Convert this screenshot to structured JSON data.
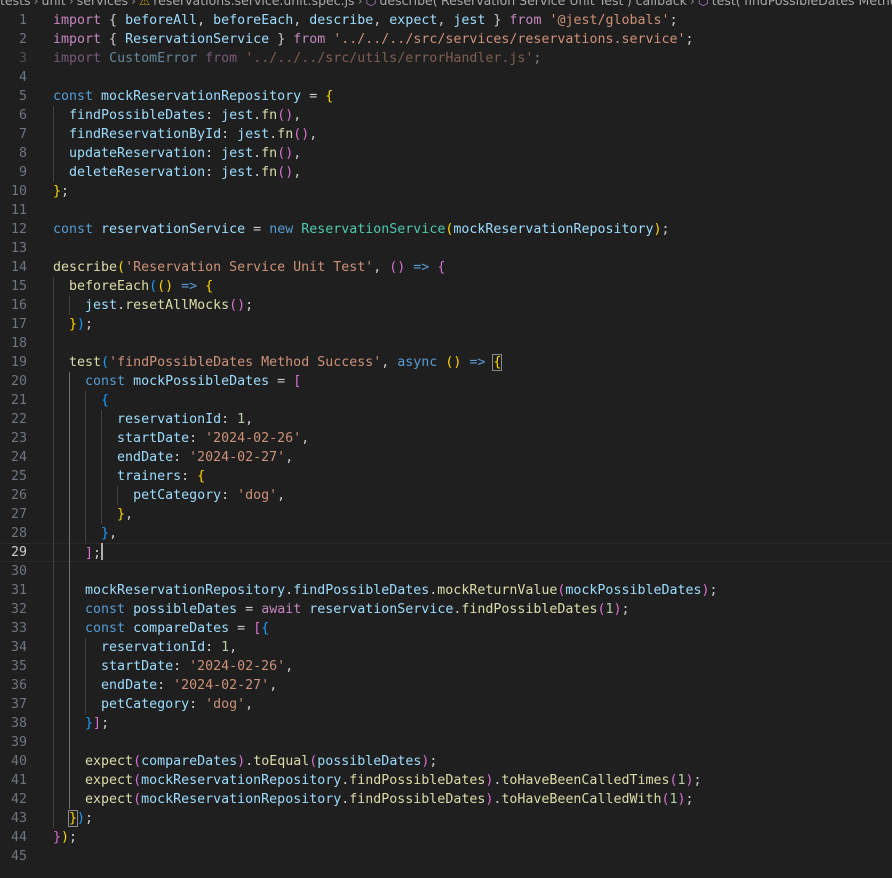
{
  "breadcrumb": {
    "parts": [
      "tests",
      "unit",
      "services",
      "reservations.service.unit.spec.js",
      "describe('Reservation Service Unit Test') callback",
      "test('findPossibleDates Method Success"
    ]
  },
  "editor": {
    "current_line": 29,
    "lines": [
      {
        "n": "1"
      },
      {
        "n": "2"
      },
      {
        "n": "3"
      },
      {
        "n": "4"
      },
      {
        "n": "5"
      },
      {
        "n": "6"
      },
      {
        "n": "7"
      },
      {
        "n": "8"
      },
      {
        "n": "9"
      },
      {
        "n": "10"
      },
      {
        "n": "11"
      },
      {
        "n": "12"
      },
      {
        "n": "13"
      },
      {
        "n": "14"
      },
      {
        "n": "15"
      },
      {
        "n": "16"
      },
      {
        "n": "17"
      },
      {
        "n": "18"
      },
      {
        "n": "19"
      },
      {
        "n": "20"
      },
      {
        "n": "21"
      },
      {
        "n": "22"
      },
      {
        "n": "23"
      },
      {
        "n": "24"
      },
      {
        "n": "25"
      },
      {
        "n": "26"
      },
      {
        "n": "27"
      },
      {
        "n": "28"
      },
      {
        "n": "29"
      },
      {
        "n": "30"
      },
      {
        "n": "31"
      },
      {
        "n": "32"
      },
      {
        "n": "33"
      },
      {
        "n": "34"
      },
      {
        "n": "35"
      },
      {
        "n": "36"
      },
      {
        "n": "37"
      },
      {
        "n": "38"
      },
      {
        "n": "39"
      },
      {
        "n": "40"
      },
      {
        "n": "41"
      },
      {
        "n": "42"
      },
      {
        "n": "43"
      },
      {
        "n": "44"
      },
      {
        "n": "45"
      }
    ]
  },
  "code": {
    "l1": [
      "import",
      " { ",
      "beforeAll",
      ", ",
      "beforeEach",
      ", ",
      "describe",
      ", ",
      "expect",
      ", ",
      "jest",
      " } ",
      "from",
      " ",
      "'@jest/globals'",
      ";"
    ],
    "l2": [
      "import",
      " { ",
      "ReservationService",
      " } ",
      "from",
      " ",
      "'../../../src/services/reservations.service'",
      ";"
    ],
    "l3": [
      "import",
      " ",
      "CustomError",
      " ",
      "from",
      " ",
      "'../../../src/utils/errorHandler.js'",
      ";"
    ],
    "l5": [
      "const",
      " ",
      "mockReservationRepository",
      " = ",
      "{"
    ],
    "l6": [
      "findPossibleDates",
      ": ",
      "jest",
      ".",
      "fn",
      "()",
      ","
    ],
    "l7": [
      "findReservationById",
      ": ",
      "jest",
      ".",
      "fn",
      "()",
      ","
    ],
    "l8": [
      "updateReservation",
      ": ",
      "jest",
      ".",
      "fn",
      "()",
      ","
    ],
    "l9": [
      "deleteReservation",
      ": ",
      "jest",
      ".",
      "fn",
      "()",
      ","
    ],
    "l10": [
      "}",
      ";"
    ],
    "l12": [
      "const",
      " ",
      "reservationService",
      " = ",
      "new",
      " ",
      "ReservationService",
      "(",
      "mockReservationRepository",
      ")",
      ";"
    ],
    "l14": [
      "describe",
      "(",
      "'Reservation Service Unit Test'",
      ", ",
      "()",
      " ",
      "=>",
      " ",
      "{"
    ],
    "l15": [
      "beforeEach",
      "(",
      "()",
      " ",
      "=>",
      " ",
      "{"
    ],
    "l16": [
      "jest",
      ".",
      "resetAllMocks",
      "()",
      ";"
    ],
    "l17": [
      "}",
      ")",
      ";"
    ],
    "l19": [
      "test",
      "(",
      "'findPossibleDates Method Success'",
      ", ",
      "async",
      " ",
      "()",
      " ",
      "=>",
      " ",
      "{"
    ],
    "l20": [
      "const",
      " ",
      "mockPossibleDates",
      " = ",
      "["
    ],
    "l21": [
      "{"
    ],
    "l22": [
      "reservationId",
      ": ",
      "1",
      ","
    ],
    "l23": [
      "startDate",
      ": ",
      "'2024-02-26'",
      ","
    ],
    "l24": [
      "endDate",
      ": ",
      "'2024-02-27'",
      ","
    ],
    "l25": [
      "trainers",
      ": ",
      "{"
    ],
    "l26": [
      "petCategory",
      ": ",
      "'dog'",
      ","
    ],
    "l27": [
      "}",
      ","
    ],
    "l28": [
      "}",
      ","
    ],
    "l29": [
      "]",
      ";"
    ],
    "l31": [
      "mockReservationRepository",
      ".",
      "findPossibleDates",
      ".",
      "mockReturnValue",
      "(",
      "mockPossibleDates",
      ")",
      ";"
    ],
    "l32": [
      "const",
      " ",
      "possibleDates",
      " = ",
      "await",
      " ",
      "reservationService",
      ".",
      "findPossibleDates",
      "(",
      "1",
      ")",
      ";"
    ],
    "l33": [
      "const",
      " ",
      "compareDates",
      " = ",
      "[",
      "{"
    ],
    "l34": [
      "reservationId",
      ": ",
      "1",
      ","
    ],
    "l35": [
      "startDate",
      ": ",
      "'2024-02-26'",
      ","
    ],
    "l36": [
      "endDate",
      ": ",
      "'2024-02-27'",
      ","
    ],
    "l37": [
      "petCategory",
      ": ",
      "'dog'",
      ","
    ],
    "l38": [
      "}",
      "]",
      ";"
    ],
    "l40": [
      "expect",
      "(",
      "compareDates",
      ")",
      ".",
      "toEqual",
      "(",
      "possibleDates",
      ")",
      ";"
    ],
    "l41": [
      "expect",
      "(",
      "mockReservationRepository",
      ".",
      "findPossibleDates",
      ")",
      ".",
      "toHaveBeenCalledTimes",
      "(",
      "1",
      ")",
      ";"
    ],
    "l42": [
      "expect",
      "(",
      "mockReservationRepository",
      ".",
      "findPossibleDates",
      ")",
      ".",
      "toHaveBeenCalledWith",
      "(",
      "1",
      ")",
      ";"
    ],
    "l43": [
      "}",
      ")",
      ";"
    ],
    "l44": [
      "}",
      ")",
      ";"
    ]
  },
  "colors": {
    "background": "#1f1f1f",
    "keyword": "#c586c0",
    "storage": "#569cd6",
    "string": "#ce9178",
    "variable": "#9cdcfe",
    "function": "#dcdcaa",
    "class": "#4ec9b0",
    "number": "#b5cea8"
  }
}
